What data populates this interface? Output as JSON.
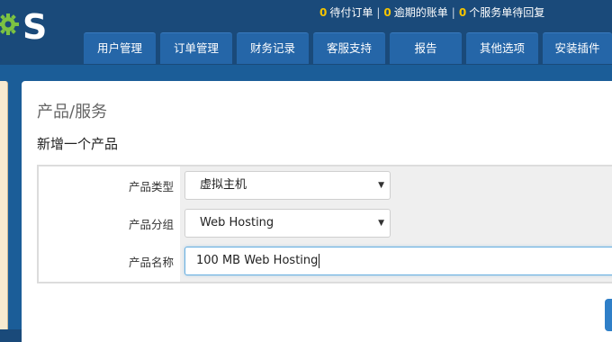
{
  "colors": {
    "header_bg": "#1a4a7a",
    "tab_bg": "#2566a8",
    "alert_number": "#f5c400",
    "logo_green": "#7cc242"
  },
  "logo": {
    "text": "S"
  },
  "alerts": [
    {
      "count": "0",
      "label": "待付订单"
    },
    {
      "count": "0",
      "label": "逾期的账单"
    },
    {
      "count": "0",
      "label": "个服务单待回复"
    }
  ],
  "nav": {
    "tabs": [
      "用户管理",
      "订单管理",
      "财务记录",
      "客服支持",
      "报告",
      "其他选项",
      "安装插件"
    ]
  },
  "page": {
    "title": "产品/服务",
    "section_title": "新增一个产品"
  },
  "form": {
    "product_type": {
      "label": "产品类型",
      "value": "虚拟主机"
    },
    "product_group": {
      "label": "产品分组",
      "value": "Web Hosting"
    },
    "product_name": {
      "label": "产品名称",
      "value": "100 MB Web Hosting"
    }
  }
}
